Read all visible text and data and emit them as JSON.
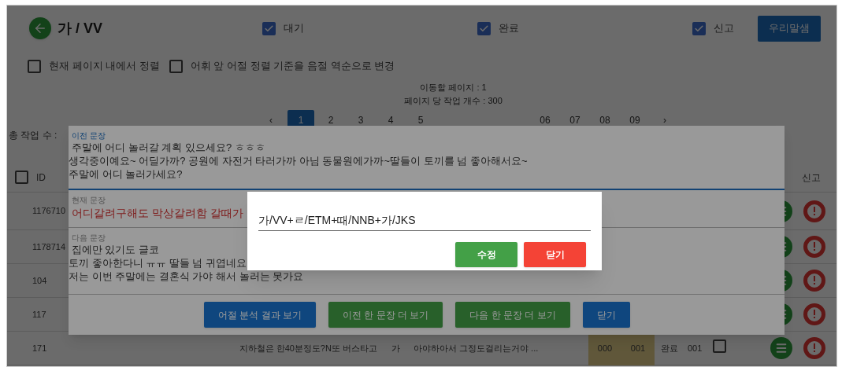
{
  "header": {
    "title": "가 / VV",
    "filters": [
      {
        "label": "대기",
        "checked": true
      },
      {
        "label": "완료",
        "checked": true
      },
      {
        "label": "신고",
        "checked": true
      }
    ],
    "button": "우리말샘"
  },
  "options": [
    {
      "label": "현재 페이지 내에서 정렬",
      "checked": false
    },
    {
      "label": "어휘 앞 어절 정렬 기준을 음절 역순으로 변경",
      "checked": false
    }
  ],
  "page_info": [
    "이동할 페이지 : 1",
    "페이지 당 작업 개수 : 300"
  ],
  "pagination": [
    {
      "label": "‹",
      "selected": false
    },
    {
      "label": "1",
      "selected": true
    },
    {
      "label": "2",
      "selected": false
    },
    {
      "label": "3",
      "selected": false
    },
    {
      "label": "4",
      "selected": false
    },
    {
      "label": "5",
      "selected": false
    },
    {
      "label": "06",
      "selected": false
    },
    {
      "label": "07",
      "selected": false
    },
    {
      "label": "08",
      "selected": false
    },
    {
      "label": "09",
      "selected": false
    },
    {
      "label": "›",
      "selected": false
    }
  ],
  "total_label": "총 작업 수 :",
  "table": {
    "header_checked": false,
    "columns": [
      "ID",
      "신고"
    ],
    "rows": [
      {
        "id": "1176710"
      },
      {
        "id": "1178714"
      },
      {
        "id": "104"
      },
      {
        "id": "117"
      },
      {
        "id": "171",
        "cells": [
          "지하철은 한40분정도?N또 버스타고",
          "가",
          "아야하아서 그정도걸리는거야 ...",
          "000",
          "001",
          "완료",
          "001"
        ],
        "checked": false
      }
    ]
  },
  "dialog": {
    "sections": [
      {
        "kind": "context",
        "label": "이전 문장",
        "lines": [
          " 주말에 어디 놀러갈 계획 있으세요? ㅎㅎㅎ",
          "생각중이예요~ 어딜가까? 공원에 자전거 타러가까 아님 동물원에가까~딸들이 토끼를 넘 좋아해서요~",
          "주말에 어디 놀러가세요?"
        ]
      },
      {
        "kind": "current",
        "label": "현재 문장",
        "lines": [
          "어디갈려구해도 막상갈려함 갈때가"
        ]
      },
      {
        "kind": "context",
        "label": "다음 문장",
        "lines": [
          " 집에만 있기도 글코",
          "토끼 좋아한다니 ㅠㅠ 딸들 넘 귀엽네요",
          "저는 이번 주말에는 결혼식 가야 해서 놀러는 못가요"
        ]
      }
    ],
    "buttons": [
      {
        "label": "어절 분석 결과 보기",
        "kind": "primary"
      },
      {
        "label": "이전 한 문장 더 보기",
        "kind": "success"
      },
      {
        "label": "다음 한 문장 더 보기",
        "kind": "success"
      },
      {
        "label": "닫기",
        "kind": "primary"
      }
    ]
  },
  "modal": {
    "value": "가/VV+ㄹ/ETM+때/NNB+가/JKS",
    "buttons": [
      {
        "label": "수정",
        "kind": "success"
      },
      {
        "label": "닫기",
        "kind": "danger"
      }
    ]
  }
}
